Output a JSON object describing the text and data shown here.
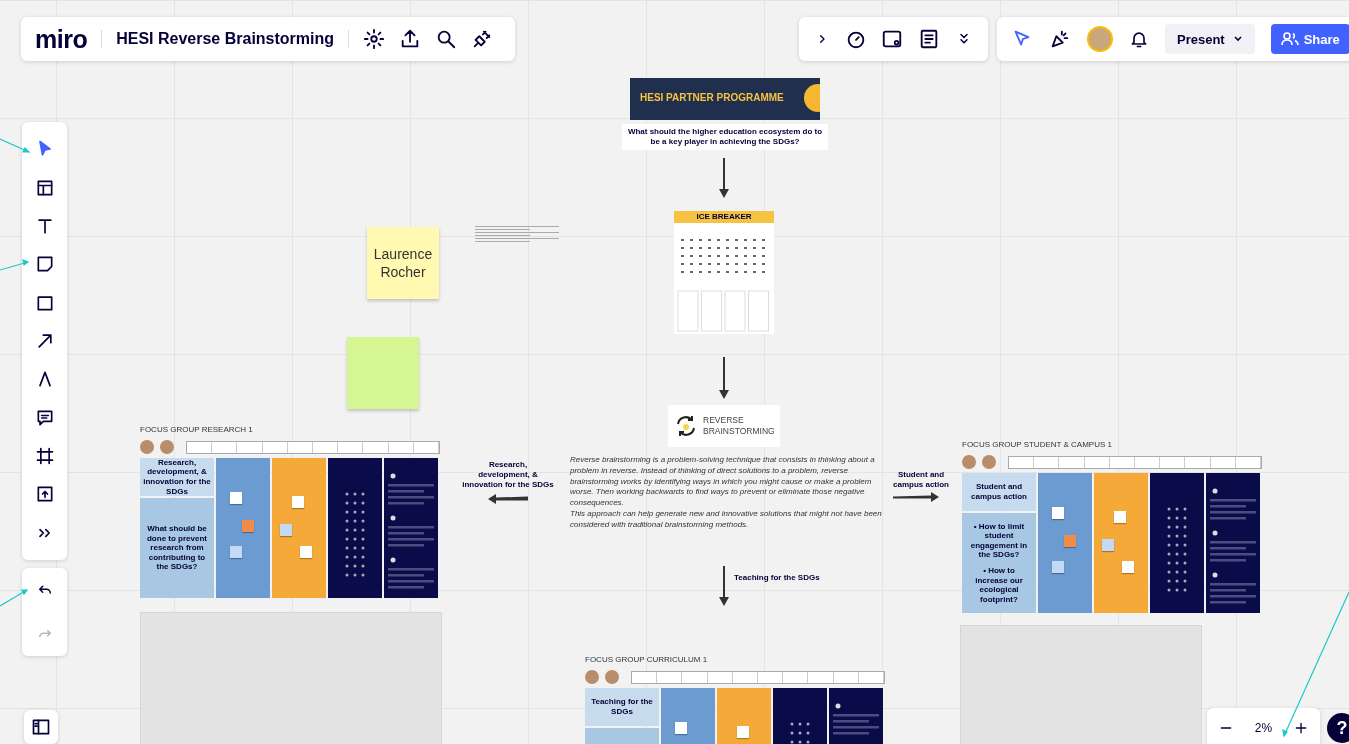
{
  "header": {
    "logo": "miro",
    "board_title": "HESI Reverse Brainstorming"
  },
  "collaboration": {
    "present": "Present",
    "share": "Share"
  },
  "zoom": {
    "value": "2%"
  },
  "help": "?",
  "canvas": {
    "programme_banner": {
      "title": "HESI PARTNER PROGRAMME"
    },
    "key_question": "What should the higher education ecosystem do to be a key player in achieving the SDGs?",
    "ice_breaker": {
      "title": "ICE BREAKER"
    },
    "reverse_card": {
      "title": "REVERSE BRAINSTORMING"
    },
    "description": [
      "Reverse brainstorming is a problem-solving technique that consists in thinking about a problem in reverse.  Instead of thinking of direct solutions to a problem, reverse brainstorming works by identifying ways in which you might cause or make a problem worse. Then working backwards to find ways to prevent or eliminate those negative consequences.",
      "This approach can help generate new and innovative solutions that might not have been considered with traditional brainstorming methods."
    ],
    "arrow_labels": [
      "Research, development, & innovation for the SDGs",
      "Student and campus action",
      "Teaching for the SDGs"
    ],
    "sticky_notes": [
      {
        "text": "Laurence Rocher",
        "color": "#fff9b1"
      },
      {
        "color": "#d5f692"
      }
    ],
    "focus_groups": [
      {
        "title": "FOCUS GROUP RESEARCH 1",
        "challenge": "Research, development, & innovation for the SDGs",
        "problem": [
          "What should be done to prevent research from contributing to the SDGs?"
        ]
      },
      {
        "title": "FOCUS GROUP STUDENT & CAMPUS 1",
        "challenge": "Student and campus action",
        "problem": [
          "• How to limit student engagement in the SDGs?",
          "• How to increase our ecological footprint?"
        ]
      },
      {
        "title": "FOCUS GROUP CURRICULUM 1",
        "challenge": "Teaching for the SDGs"
      }
    ]
  }
}
